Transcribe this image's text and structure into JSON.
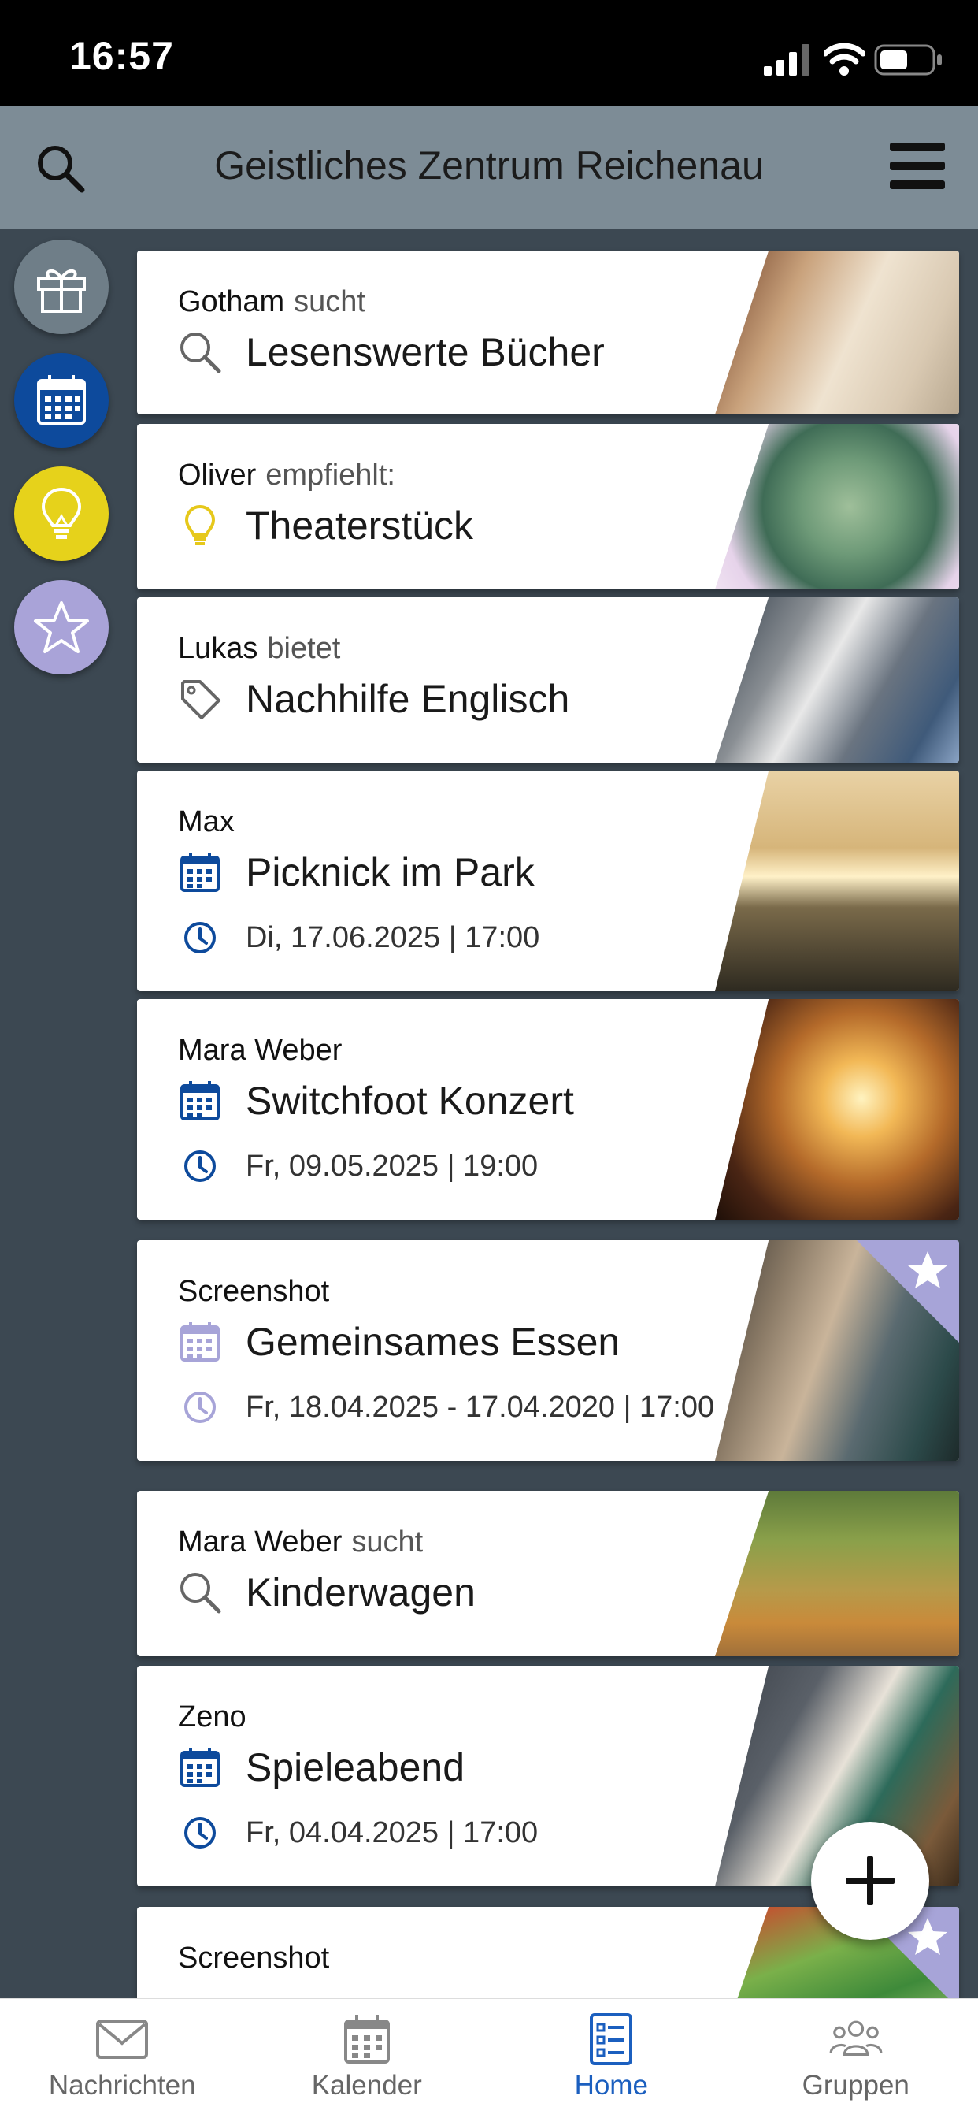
{
  "status_bar": {
    "time": "16:57"
  },
  "header": {
    "title": "Geistliches Zentrum Reichenau",
    "search_icon": "search-icon",
    "menu_icon": "hamburger-menu-icon"
  },
  "sidebar": [
    {
      "icon": "gift-icon",
      "color": "#6f7e88"
    },
    {
      "icon": "calendar-icon",
      "color": "#0d4a9c"
    },
    {
      "icon": "lightbulb-icon",
      "color": "#e6d21b"
    },
    {
      "icon": "star-icon",
      "color": "#a9a3d8"
    }
  ],
  "cards": [
    {
      "user": "Gotham",
      "verb": "sucht",
      "title": "Lesenswerte Bücher",
      "icon": "search-icon",
      "image": "open-book"
    },
    {
      "user": "Oliver",
      "verb": "empfiehlt:",
      "title": "Theaterstück",
      "icon": "lightbulb-icon",
      "image": "succulent"
    },
    {
      "user": "Lukas",
      "verb": "bietet",
      "title": "Nachhilfe Englisch",
      "icon": "tag-icon",
      "image": "notebook-writing"
    },
    {
      "user": "Max",
      "verb": "",
      "title": "Picknick im Park",
      "icon": "calendar-icon",
      "date": "Di, 17.06.2025 | 17:00",
      "image": "park-skyline"
    },
    {
      "user": "Mara Weber",
      "verb": "",
      "title": "Switchfoot Konzert",
      "icon": "calendar-icon",
      "date": "Fr, 09.05.2025 | 19:00",
      "image": "concert"
    },
    {
      "user": "Screenshot",
      "verb": "",
      "title": "Gemeinsames Essen",
      "icon": "calendar-icon",
      "date": "Fr, 18.04.2025 - 17.04.2020 | 17:00",
      "image": "friends-dinner",
      "starred": true
    },
    {
      "user": "Mara Weber",
      "verb": "sucht",
      "title": "Kinderwagen",
      "icon": "search-icon",
      "image": "family-walk"
    },
    {
      "user": "Zeno",
      "verb": "",
      "title": "Spieleabend",
      "icon": "calendar-icon",
      "date": "Fr, 04.04.2025 | 17:00",
      "image": "chess-game"
    },
    {
      "user": "Screenshot",
      "verb": "",
      "title": "",
      "icon": "calendar-icon",
      "image": "fruits",
      "starred": true
    }
  ],
  "fab": {
    "icon": "plus-icon"
  },
  "tabs": [
    {
      "label": "Nachrichten",
      "icon": "mail-icon"
    },
    {
      "label": "Kalender",
      "icon": "calendar-icon"
    },
    {
      "label": "Home",
      "icon": "home-list-icon",
      "active": true
    },
    {
      "label": "Gruppen",
      "icon": "group-icon"
    }
  ],
  "colors": {
    "header_bg": "#7d8c96",
    "page_bg": "#3c4852",
    "accent_blue": "#0d4a9c",
    "accent_yellow": "#e6d21b",
    "accent_purple": "#a9a3d8",
    "tab_active": "#1b5fbf"
  }
}
